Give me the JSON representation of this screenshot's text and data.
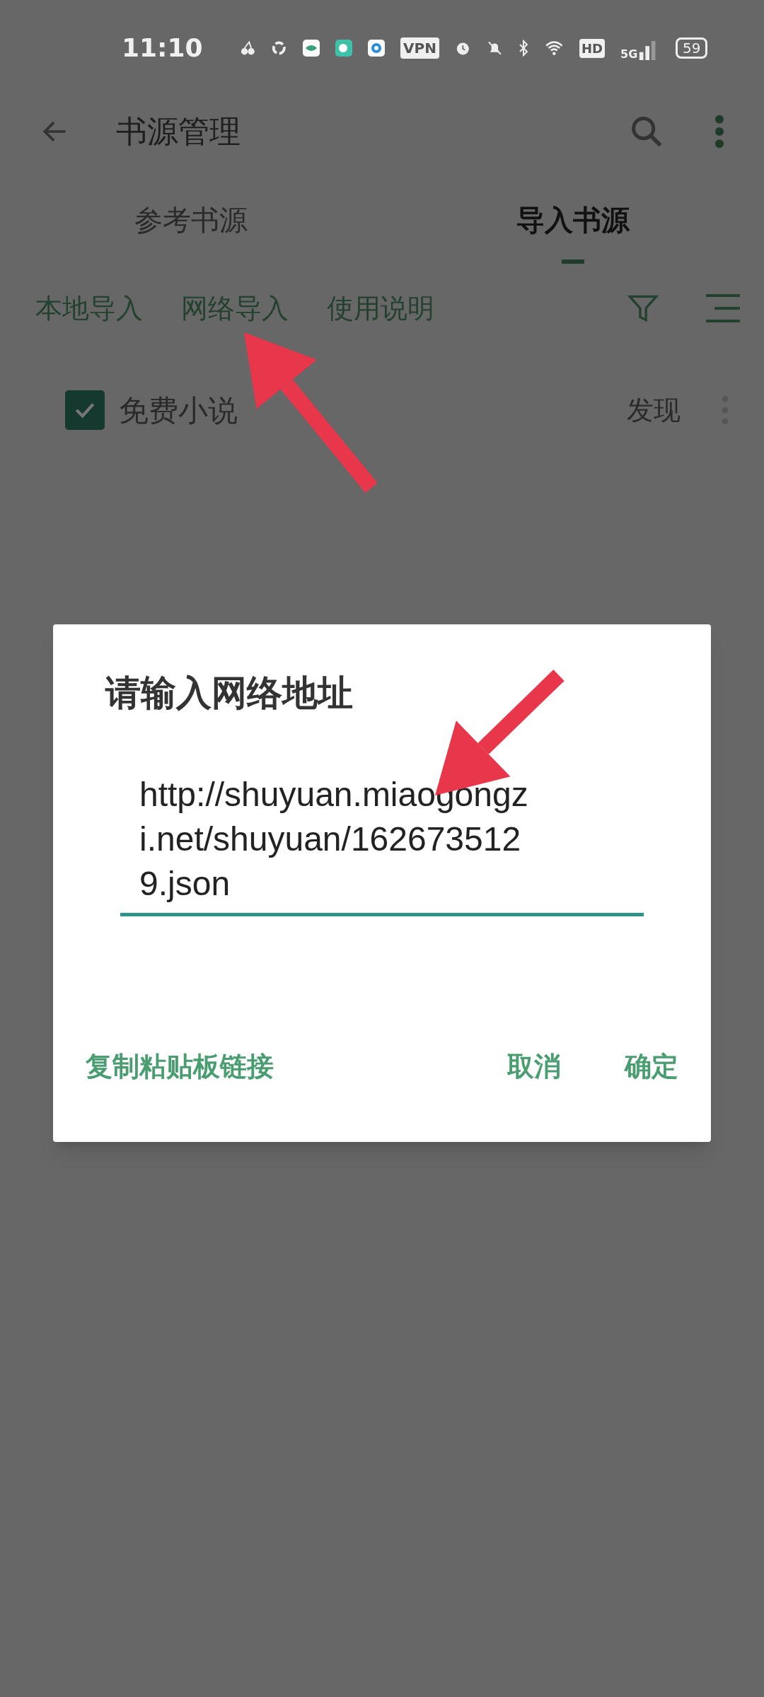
{
  "status_bar": {
    "time": "11:10",
    "vpn": "VPN",
    "hd": "HD",
    "network": "5G",
    "battery": "59"
  },
  "toolbar": {
    "title": "书源管理"
  },
  "tabs": [
    {
      "label": "参考书源",
      "selected": false
    },
    {
      "label": "导入书源",
      "selected": true
    }
  ],
  "actions": [
    "本地导入",
    "网络导入",
    "使用说明"
  ],
  "sources": [
    {
      "name": "免费小说",
      "checked": true,
      "action": "发现"
    }
  ],
  "dialog": {
    "title": "请输入网络地址",
    "value": "http://shuyuan.miaogongzi.net/shuyuan/1626735129.json",
    "buttons": [
      "复制粘贴板链接",
      "取消",
      "确定"
    ]
  }
}
